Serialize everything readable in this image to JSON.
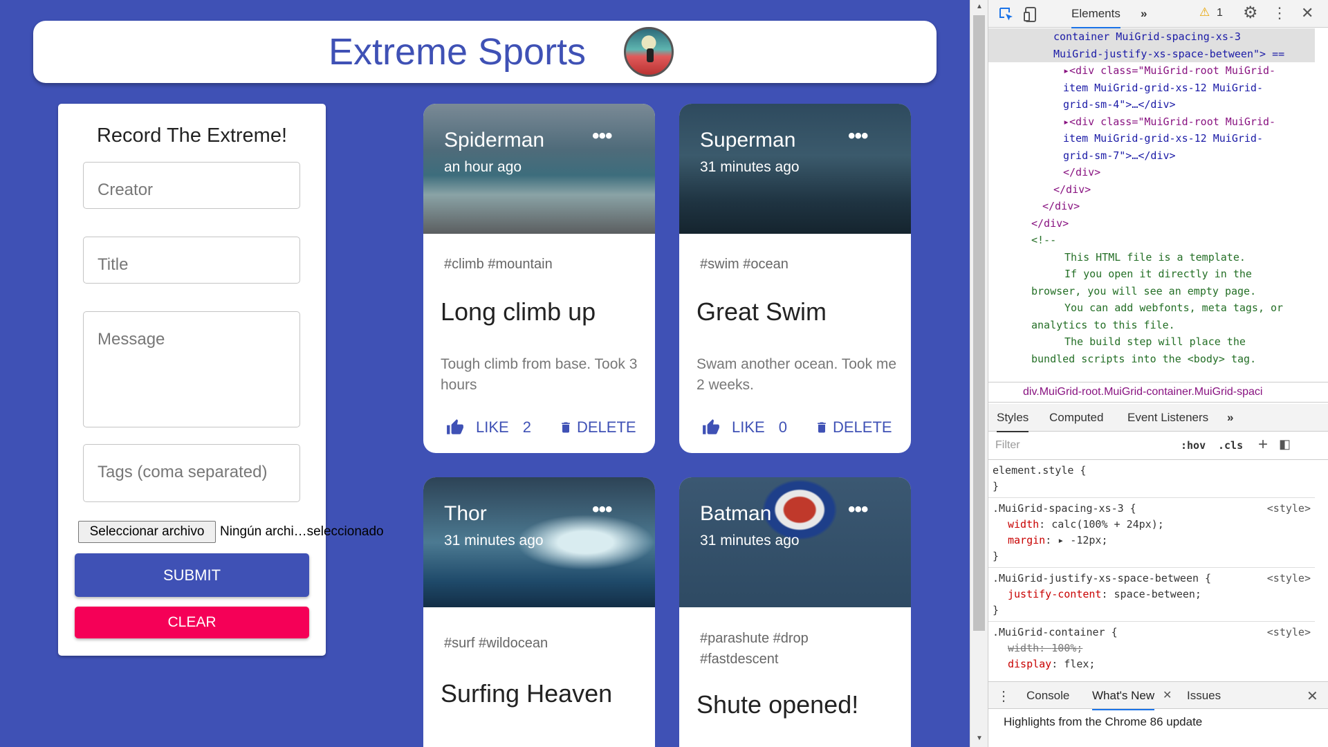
{
  "header": {
    "title": "Extreme Sports",
    "logo": "extreme-sports-logo"
  },
  "form": {
    "title": "Record The Extreme!",
    "creator_placeholder": "Creator",
    "title_placeholder": "Title",
    "message_placeholder": "Message",
    "tags_placeholder": "Tags (coma separated)",
    "file_button": "Seleccionar archivo",
    "file_name": "Ningún archi…seleccionado",
    "submit_label": "SUBMIT",
    "clear_label": "CLEAR"
  },
  "posts": [
    {
      "creator": "Spiderman",
      "time": "an hour ago",
      "tags": "#climb #mountain",
      "title": "Long climb up",
      "message": "Tough climb from base. Took 3 hours",
      "like_label": "LIKE",
      "likes": "2",
      "delete_label": "DELETE"
    },
    {
      "creator": "Superman",
      "time": "31 minutes ago",
      "tags": "#swim #ocean",
      "title": "Great Swim",
      "message": "Swam another ocean. Took me 2 weeks.",
      "like_label": "LIKE",
      "likes": "0",
      "delete_label": "DELETE"
    },
    {
      "creator": "Thor",
      "time": "31 minutes ago",
      "tags": "#surf #wildocean",
      "title": "Surfing Heaven"
    },
    {
      "creator": "Batman",
      "time": "31 minutes ago",
      "tags": "#parashute #drop #fastdescent",
      "title": "Shute opened!"
    }
  ],
  "devtools": {
    "tabs": {
      "elements": "Elements",
      "more": "»",
      "warnings": "1"
    },
    "dom_lines": [
      "container MuiGrid-spacing-xs-3",
      "MuiGrid-justify-xs-space-between\"> ==",
      "▸<div class=\"MuiGrid-root MuiGrid-",
      "item MuiGrid-grid-xs-12 MuiGrid-",
      "grid-sm-4\">…</div>",
      "▸<div class=\"MuiGrid-root MuiGrid-",
      "item MuiGrid-grid-xs-12 MuiGrid-",
      "grid-sm-7\">…</div>",
      "</div>",
      "</div>",
      "</div>",
      "</div>",
      "<!--",
      "This HTML file is a template.",
      "If you open it directly in the",
      "browser, you will see an empty page.",
      "",
      "You can add webfonts, meta tags, or",
      "analytics to this file.",
      "The build step will place the",
      "bundled scripts into the <body> tag."
    ],
    "breadcrumb": "div.MuiGrid-root.MuiGrid-container.MuiGrid-spaci",
    "styles_tabs": {
      "styles": "Styles",
      "computed": "Computed",
      "listeners": "Event Listeners",
      "more": "»"
    },
    "filter_placeholder": "Filter",
    "hov": ":hov",
    "cls": ".cls",
    "rules": [
      {
        "selector": "element.style {",
        "src": "",
        "props": [],
        "close": "}"
      },
      {
        "selector": ".MuiGrid-spacing-xs-3 {",
        "src": "<style>",
        "props": [
          [
            "width",
            "calc(100% + 24px);"
          ],
          [
            "margin",
            "▸ -12px;"
          ]
        ],
        "close": "}"
      },
      {
        "selector": ".MuiGrid-justify-xs-space-between {",
        "src": "<style>",
        "props": [
          [
            "justify-content",
            "space-between;"
          ]
        ],
        "close": "}"
      },
      {
        "selector": ".MuiGrid-container {",
        "src": "<style>",
        "props": [
          [
            "width",
            "100%;"
          ],
          [
            "display",
            "flex;"
          ]
        ],
        "close": ""
      }
    ],
    "drawer": {
      "console": "Console",
      "whats_new": "What's New",
      "issues": "Issues"
    },
    "highlights": "Highlights from the Chrome 86 update"
  }
}
